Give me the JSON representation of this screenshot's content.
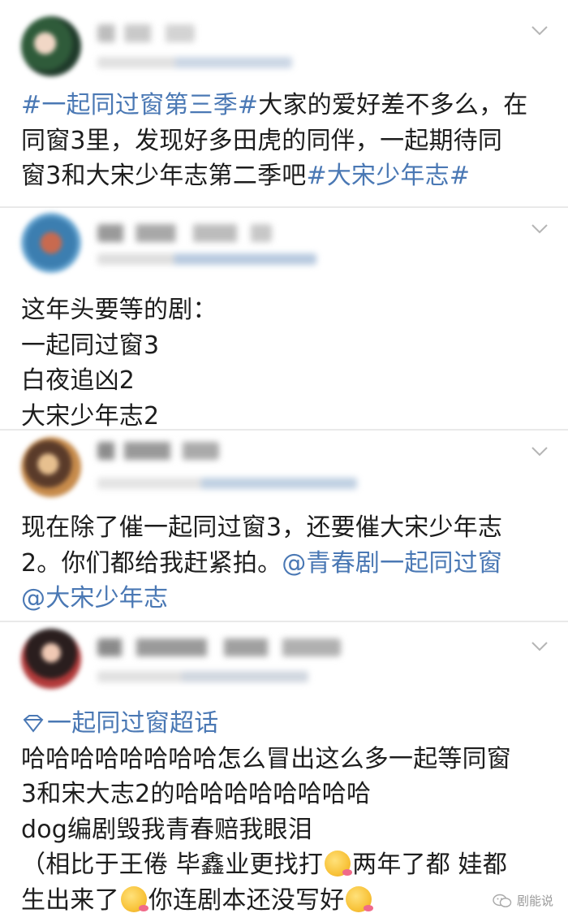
{
  "colors": {
    "link": "#4a78b4",
    "text": "#1d1d1d",
    "separator": "#e9e9e9",
    "chevron": "#b5b5b5"
  },
  "posts": [
    {
      "lines": [
        [
          {
            "t": "#一起同过窗第三季#",
            "link": true
          },
          {
            "t": "大家的爱好差不多么，在",
            "link": false
          }
        ],
        [
          {
            "t": "同窗3里，发现好多田虎的同伴，一起期待同",
            "link": false
          }
        ],
        [
          {
            "t": "窗3和大宋少年志第二季吧",
            "link": false
          },
          {
            "t": "#大宋少年志#",
            "link": true
          }
        ]
      ]
    },
    {
      "lines": [
        [
          {
            "t": "这年头要等的剧：",
            "link": false
          }
        ],
        [
          {
            "t": "一起同过窗3",
            "link": false
          }
        ],
        [
          {
            "t": "白夜追凶2",
            "link": false
          }
        ],
        [
          {
            "t": "大宋少年志2",
            "link": false
          }
        ]
      ]
    },
    {
      "lines": [
        [
          {
            "t": "现在除了催一起同过窗3，还要催大宋少年志",
            "link": false
          }
        ],
        [
          {
            "t": "2。你们都给我赶紧拍。",
            "link": false
          },
          {
            "t": "@青春剧一起同过窗",
            "link": true
          }
        ],
        [
          {
            "t": "@大宋少年志",
            "link": true
          }
        ]
      ]
    },
    {
      "topic": "一起同过窗超话",
      "lines": [
        [
          {
            "t": "哈哈哈哈哈哈哈哈怎么冒出这么多一起等同窗",
            "link": false
          }
        ],
        [
          {
            "t": "3和宋大志2的哈哈哈哈哈哈哈哈",
            "link": false
          }
        ],
        [
          {
            "t": "dog编剧毁我青春赔我眼泪",
            "link": false
          }
        ],
        [
          {
            "t": "（相比于王倦 毕鑫业更找打",
            "link": false
          },
          {
            "emoji": "yum-face"
          },
          {
            "t": "两年了都 娃都",
            "link": false
          }
        ],
        [
          {
            "t": "生出来了",
            "link": false
          },
          {
            "emoji": "yum-face"
          },
          {
            "t": "你连剧本还没写好",
            "link": false
          },
          {
            "emoji": "yum-face"
          }
        ]
      ]
    }
  ],
  "watermark": {
    "label": "剧能说",
    "icon": "wechat-icon"
  }
}
